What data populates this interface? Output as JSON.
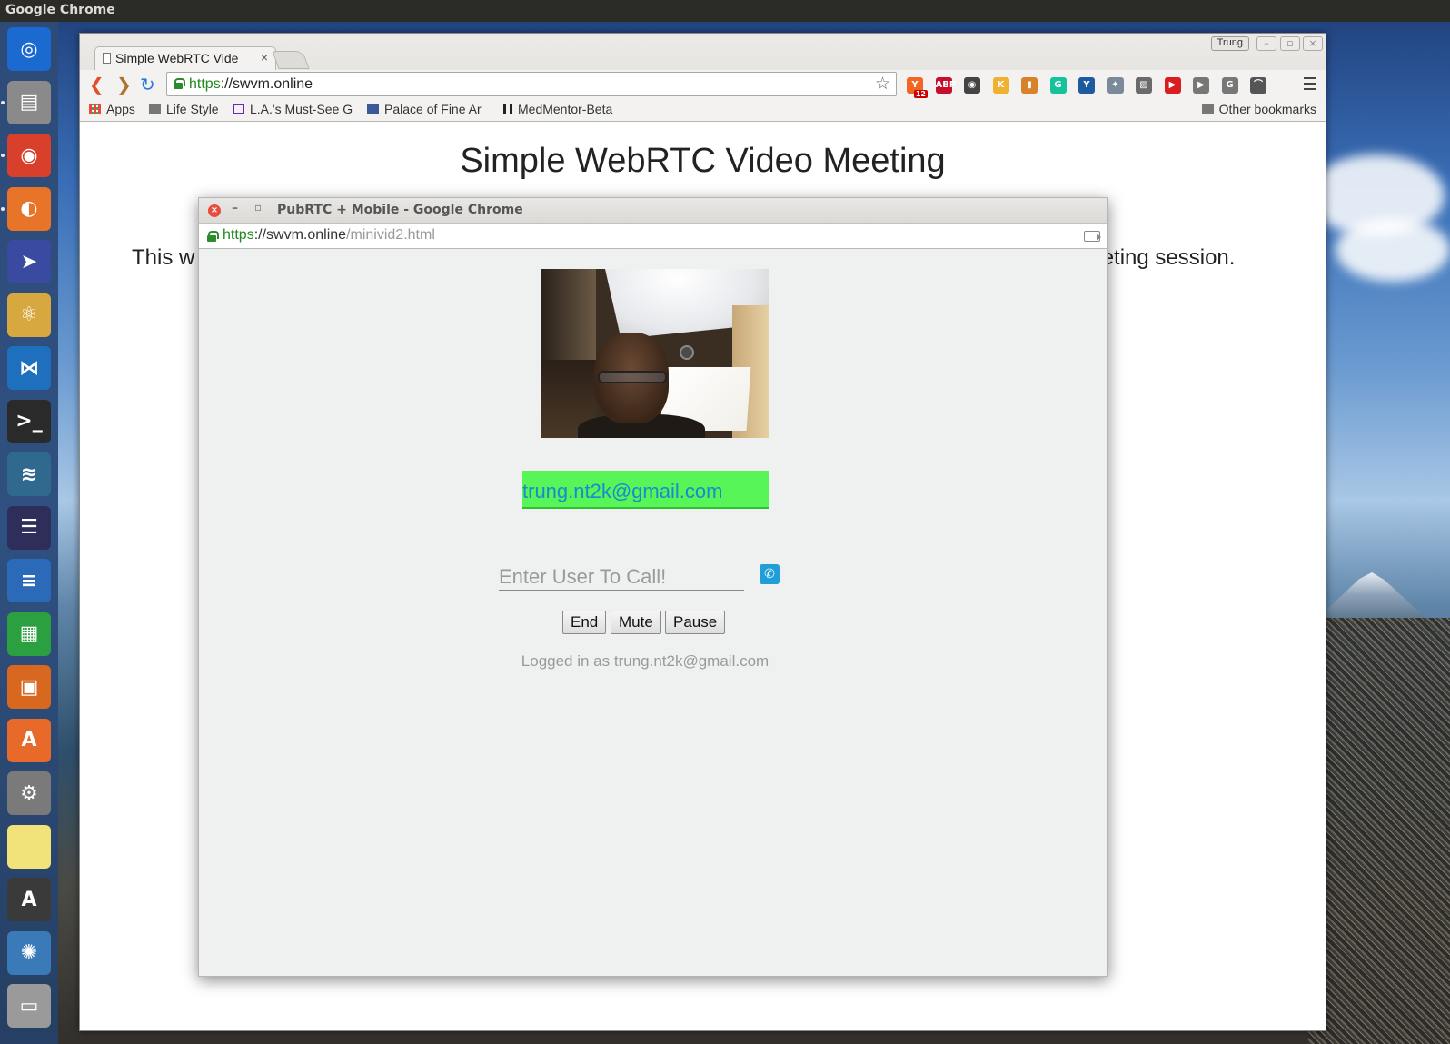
{
  "top_panel": {
    "app_name": "Google Chrome"
  },
  "launcher": {
    "items": [
      {
        "name": "ubuntu-dash-icon",
        "glyph": "◎",
        "color": "#1a6ad0"
      },
      {
        "name": "files-icon",
        "glyph": "▤",
        "color": "#8a8a8a"
      },
      {
        "name": "chrome-icon",
        "glyph": "◉",
        "color": "#d9402b"
      },
      {
        "name": "firefox-icon",
        "glyph": "◐",
        "color": "#e8742a"
      },
      {
        "name": "screen-share-icon",
        "glyph": "➤",
        "color": "#3a4aa0"
      },
      {
        "name": "atom-icon",
        "glyph": "⚛",
        "color": "#d8a840"
      },
      {
        "name": "vscode-icon",
        "glyph": "⋈",
        "color": "#1f6fbf"
      },
      {
        "name": "terminal-icon",
        "glyph": ">_",
        "color": "#2a2a2a"
      },
      {
        "name": "mysql-workbench-icon",
        "glyph": "≋",
        "color": "#2f6a8e"
      },
      {
        "name": "eclipse-icon",
        "glyph": "☰",
        "color": "#2e2e5a"
      },
      {
        "name": "writer-icon",
        "glyph": "≡",
        "color": "#2a6ab8"
      },
      {
        "name": "calc-icon",
        "glyph": "▦",
        "color": "#2aa040"
      },
      {
        "name": "impress-icon",
        "glyph": "▣",
        "color": "#d86820"
      },
      {
        "name": "software-center-icon",
        "glyph": "A",
        "color": "#e86a2a"
      },
      {
        "name": "settings-icon",
        "glyph": "⚙",
        "color": "#7a7a7a"
      },
      {
        "name": "sticky-notes-icon",
        "glyph": "",
        "color": "#f2e27a"
      },
      {
        "name": "updater-icon",
        "glyph": "A",
        "color": "#3a3a3a"
      },
      {
        "name": "darktable-icon",
        "glyph": "✺",
        "color": "#3a7ab8"
      },
      {
        "name": "usb-drive-icon",
        "glyph": "▭",
        "color": "#9a9a9a"
      }
    ]
  },
  "browser": {
    "tab_title": "Simple WebRTC Vide",
    "profile_name": "Trung",
    "url_scheme": "https",
    "url_rest": "://swvm.online",
    "extensions": [
      {
        "name": "hn-extension-icon",
        "label": "Y",
        "color": "#f26522",
        "badge": "12"
      },
      {
        "name": "adblock-plus-icon",
        "label": "ABP",
        "color": "#c70d2c"
      },
      {
        "name": "ghostery-icon",
        "label": "◉",
        "color": "#444"
      },
      {
        "name": "kanbanflow-icon",
        "label": "K",
        "color": "#f0b030"
      },
      {
        "name": "keep-icon",
        "label": "▮",
        "color": "#d8822a"
      },
      {
        "name": "grammarly-icon",
        "label": "G",
        "color": "#15c39a"
      },
      {
        "name": "vimium-icon",
        "label": "Y",
        "color": "#1f5aa0"
      },
      {
        "name": "dropbox-icon",
        "label": "✦",
        "color": "#7a8a9a"
      },
      {
        "name": "screenshot-icon",
        "label": "▨",
        "color": "#6a6a6a"
      },
      {
        "name": "youtube-icon",
        "label": "▶",
        "color": "#d81e1e"
      },
      {
        "name": "pushbullet-icon",
        "label": "▶",
        "color": "#777"
      },
      {
        "name": "gmail-offline-icon",
        "label": "G",
        "color": "#777"
      },
      {
        "name": "bookmark-sync-icon",
        "label": "⌒",
        "color": "#555"
      }
    ],
    "bookmarks": [
      {
        "name": "bookmark-apps",
        "label": "Apps",
        "icon": "apps-grid-icon"
      },
      {
        "name": "bookmark-life-style",
        "label": "Life Style",
        "icon": "folder-icon"
      },
      {
        "name": "bookmark-la-must-see",
        "label": "L.A.'s Must-See G",
        "icon": "link-icon"
      },
      {
        "name": "bookmark-palace-fine-art",
        "label": "Palace of Fine Ar",
        "icon": "facebook-icon"
      },
      {
        "name": "bookmark-medmentor",
        "label": "MedMentor-Beta",
        "icon": "caduceus-icon"
      }
    ],
    "other_bookmarks": "Other bookmarks"
  },
  "page": {
    "title": "Simple WebRTC Video Meeting",
    "text_left": "This w",
    "text_right": "neeting session."
  },
  "popup": {
    "window_title": "PubRTC + Mobile - Google Chrome",
    "url_scheme": "https",
    "url_host": "://swvm.online",
    "url_path": "/minivid2.html",
    "username_display": "trung.nt2k@gmail.com",
    "call_placeholder": "Enter User To Call!",
    "buttons": {
      "end": "End",
      "mute": "Mute",
      "pause": "Pause"
    },
    "logged_in_text": "Logged in as trung.nt2k@gmail.com"
  },
  "colors": {
    "accent_green": "#57f557",
    "link_blue": "#1a8ad0",
    "call_button_blue": "#1f9ed8"
  }
}
